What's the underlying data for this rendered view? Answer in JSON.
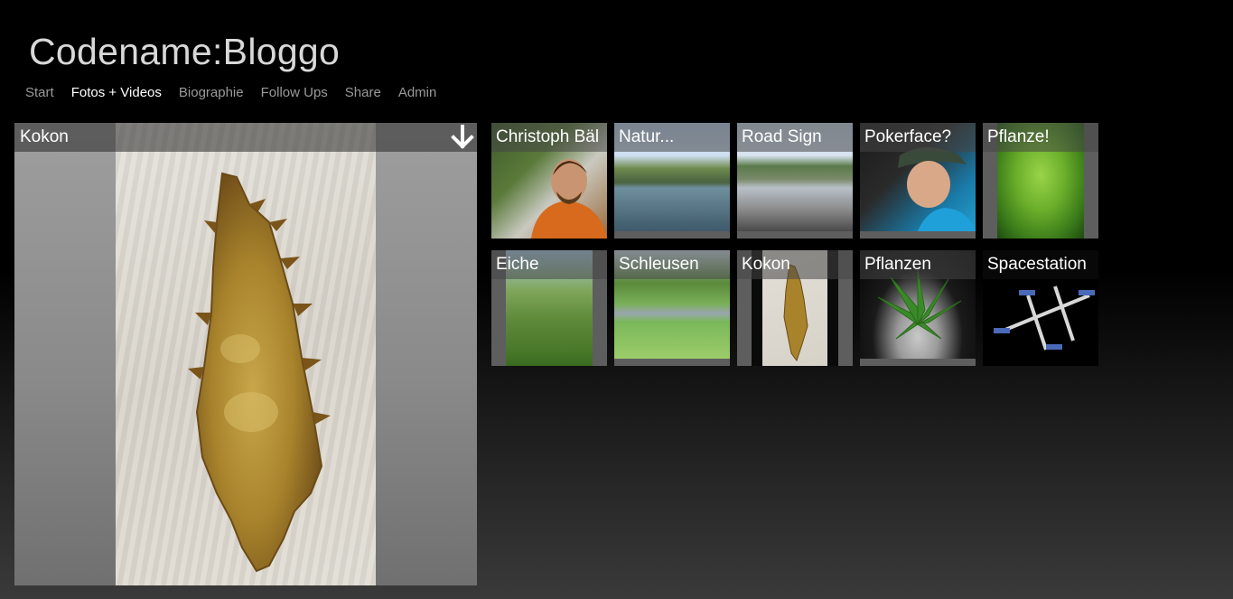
{
  "header": {
    "title": "Codename:Bloggo"
  },
  "nav": {
    "items": [
      {
        "label": "Start",
        "active": false
      },
      {
        "label": "Fotos + Videos",
        "active": true
      },
      {
        "label": "Biographie",
        "active": false
      },
      {
        "label": "Follow Ups",
        "active": false
      },
      {
        "label": "Share",
        "active": false
      },
      {
        "label": "Admin",
        "active": false
      }
    ]
  },
  "viewer": {
    "title": "Kokon",
    "download_icon": "arrow-down-icon"
  },
  "tiles": [
    {
      "label": "Christoph Bäl"
    },
    {
      "label": "Natur..."
    },
    {
      "label": "Road Sign"
    },
    {
      "label": "Pokerface?"
    },
    {
      "label": "Pflanze!"
    },
    {
      "label": "Eiche"
    },
    {
      "label": "Schleusen"
    },
    {
      "label": "Kokon"
    },
    {
      "label": "Pflanzen"
    },
    {
      "label": "Spacestation"
    }
  ],
  "colors": {
    "background": "#000000",
    "nav_inactive": "#9a9a9a",
    "nav_active": "#ffffff",
    "tile_frame": "#5e5e5e"
  }
}
